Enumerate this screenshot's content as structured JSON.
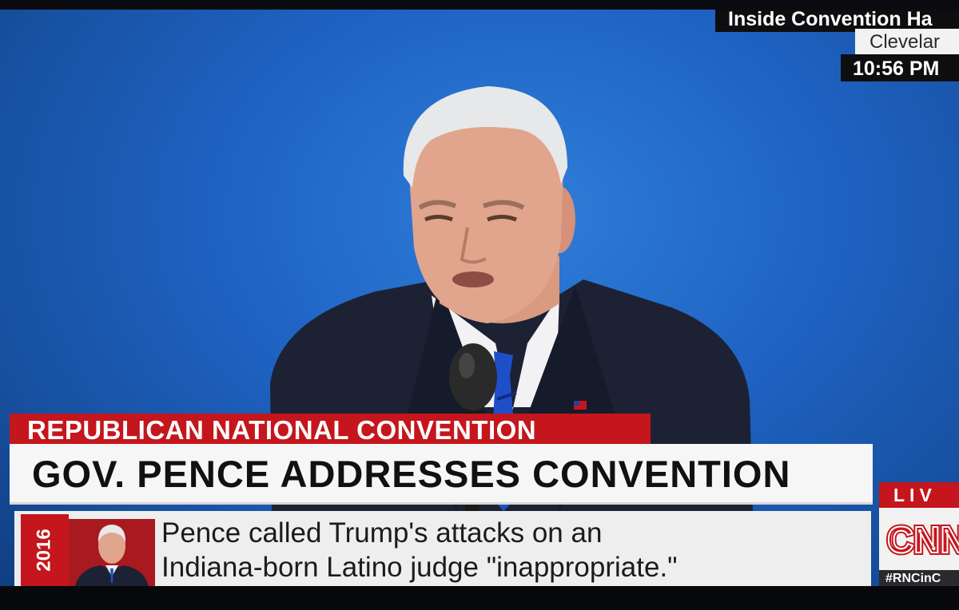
{
  "bug": {
    "program_title": "Inside Convention Ha",
    "location": "Clevelar",
    "time": "10:56 PM"
  },
  "lower_third": {
    "kicker": "REPUBLICAN NATIONAL CONVENTION",
    "headline": "GOV. PENCE ADDRESSES CONVENTION",
    "ticker_year": "2016",
    "ticker_line_1": "Pence called Trump's attacks on an",
    "ticker_line_2": "Indiana-born Latino judge \"inappropriate.\""
  },
  "network": {
    "live_label": "LIV",
    "logo_text": "CNN",
    "hashtag": "#RNCinC"
  },
  "colors": {
    "backdrop_blue": "#1f63c4",
    "accent_red": "#c4161c",
    "panel_white": "#f6f6f6",
    "dark": "#0e0e10"
  },
  "icons": {
    "network_logo": "cnn-logo",
    "flag_pin": "us-flag-pin-icon",
    "microphone": "microphone-icon"
  }
}
